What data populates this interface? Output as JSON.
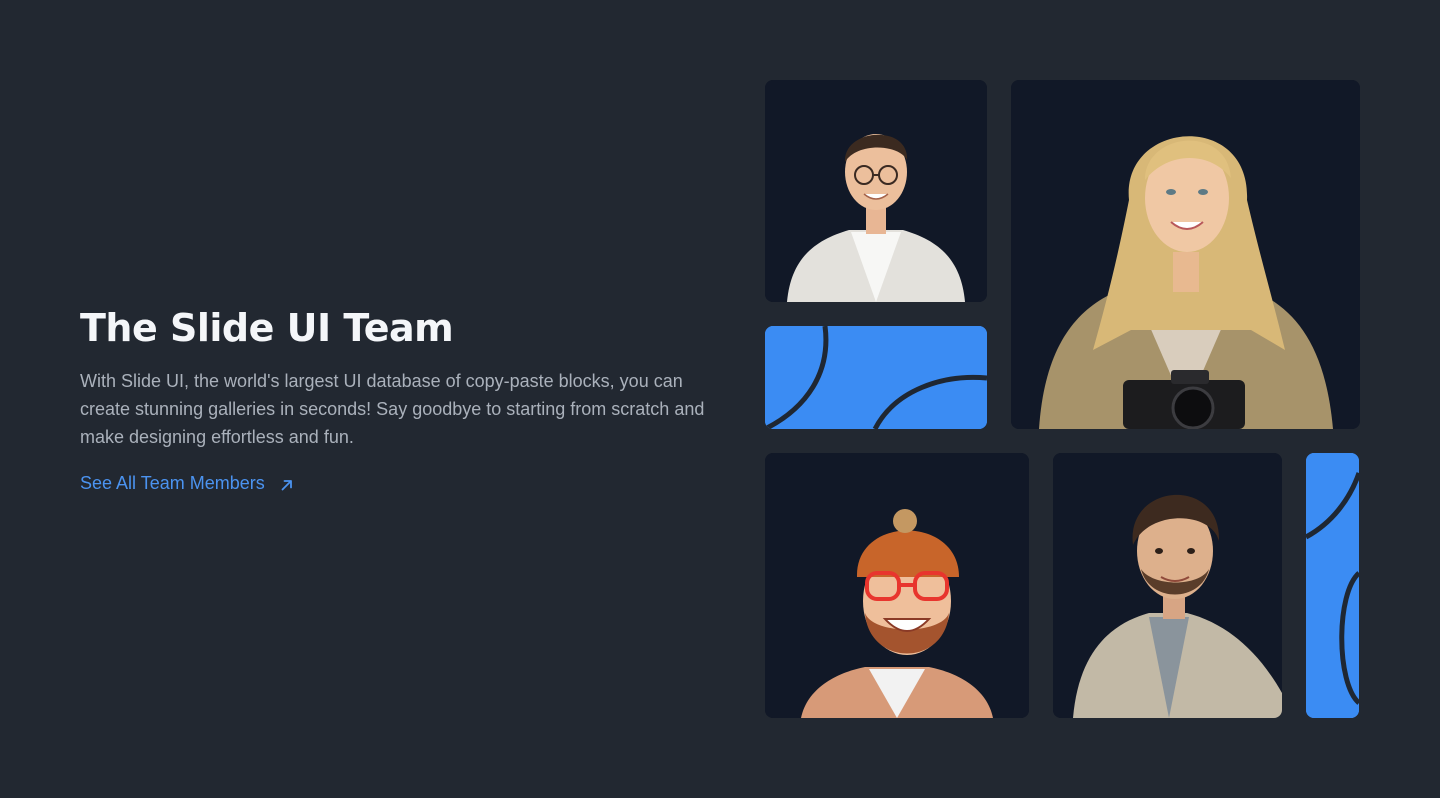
{
  "header": {
    "title": "The Slide UI Team",
    "description": "With Slide UI, the world's largest UI database of copy-paste blocks, you can create stunning galleries in seconds! Say goodbye to starting from scratch and make designing effortless and fun.",
    "link_label": "See All Team Members",
    "link_icon": "arrow-up-right-icon"
  },
  "gallery": {
    "members": [
      {
        "slot": "top-left",
        "depicts": "man-with-glasses-white-shirt"
      },
      {
        "slot": "top-right-large",
        "depicts": "blonde-woman-with-camera"
      },
      {
        "slot": "bottom-left",
        "depicts": "bearded-man-orange-beanie"
      },
      {
        "slot": "bottom-middle",
        "depicts": "man-in-beige-jacket"
      }
    ],
    "decorations": [
      "blue-arc-tile",
      "blue-arc-strip"
    ]
  },
  "colors": {
    "background": "#222831",
    "tile_background": "#111827",
    "accent": "#3b8cf3",
    "link": "#4b93f0",
    "title": "#f4f6f9",
    "body_text": "#aab1bb"
  }
}
